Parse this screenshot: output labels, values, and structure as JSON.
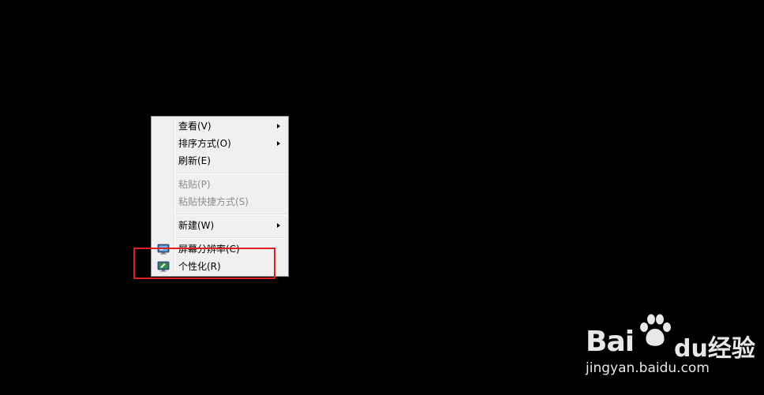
{
  "context_menu": {
    "items": [
      {
        "label": "查看(V)",
        "submenu": true,
        "enabled": true,
        "icon": ""
      },
      {
        "label": "排序方式(O)",
        "submenu": true,
        "enabled": true,
        "icon": ""
      },
      {
        "label": "刷新(E)",
        "submenu": false,
        "enabled": true,
        "icon": ""
      },
      {
        "label": "粘贴(P)",
        "submenu": false,
        "enabled": false,
        "icon": ""
      },
      {
        "label": "粘贴快捷方式(S)",
        "submenu": false,
        "enabled": false,
        "icon": ""
      },
      {
        "label": "新建(W)",
        "submenu": true,
        "enabled": true,
        "icon": ""
      },
      {
        "label": "屏幕分辨率(C)",
        "submenu": false,
        "enabled": true,
        "icon": "screen-resolution-icon"
      },
      {
        "label": "个性化(R)",
        "submenu": false,
        "enabled": true,
        "icon": "personalize-icon"
      }
    ]
  },
  "highlight": {
    "color": "#e02020"
  },
  "watermark": {
    "brand": "Bai",
    "brand_suffix": "du经验",
    "url": "jingyan.baidu.com"
  }
}
